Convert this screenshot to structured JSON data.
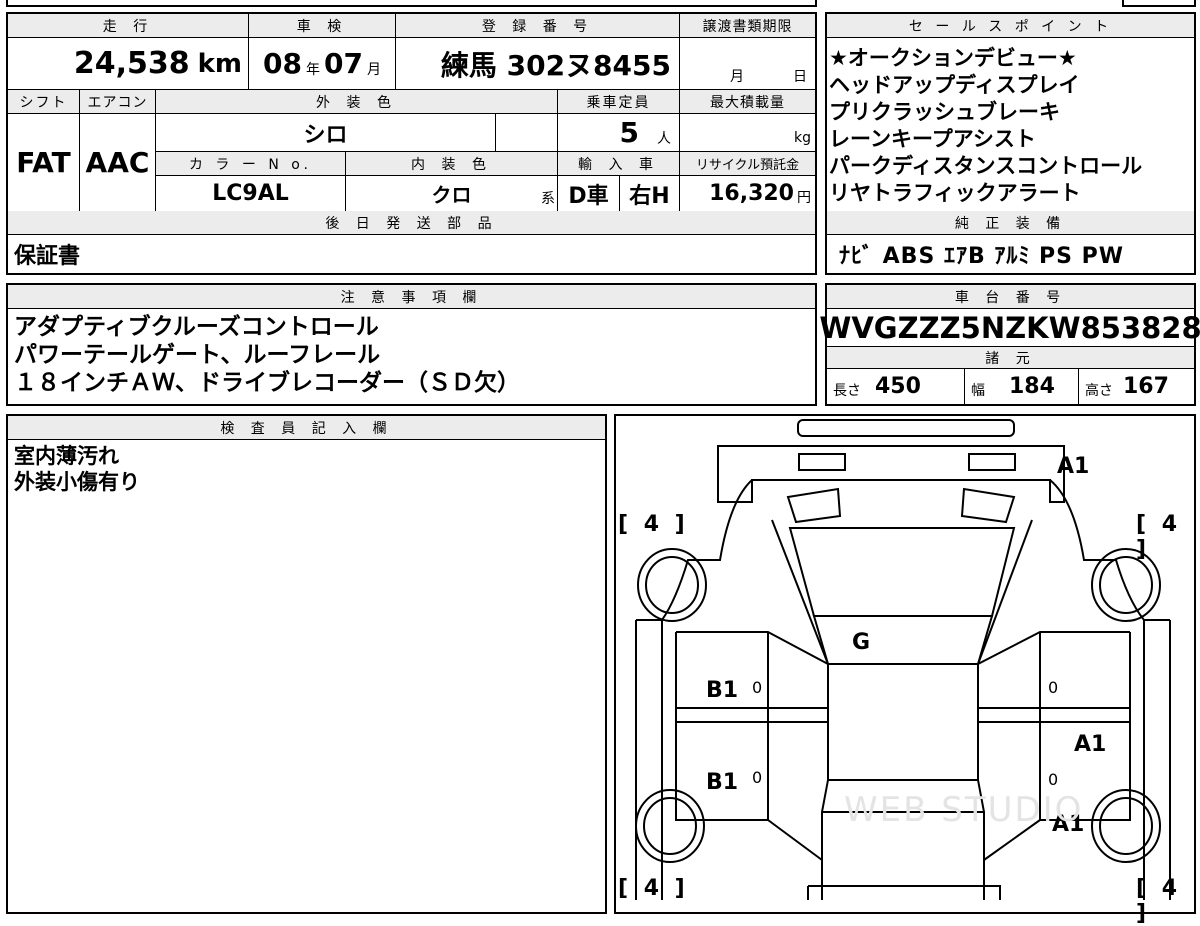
{
  "top": {
    "mileage_label": "走 行",
    "mileage_value": "24,538",
    "mileage_unit": "km",
    "shaken_label": "車 検",
    "shaken_year": "08",
    "shaken_year_unit": "年",
    "shaken_month": "07",
    "shaken_month_unit": "月",
    "reg_label": "登 録 番 号",
    "reg_value": "練馬 302ヌ8455",
    "transfer_label": "譲渡書類期限",
    "transfer_month": "月",
    "transfer_day": "日"
  },
  "mid": {
    "shift_label": "シフト",
    "shift_value": "FAT",
    "ac_label": "エアコン",
    "ac_value": "AAC",
    "color_label": "外 装 色",
    "color_value": "シロ",
    "capacity_label": "乗車定員",
    "capacity_value": "5",
    "capacity_unit": "人",
    "load_label": "最大積載量",
    "load_unit": "kg",
    "color_no_label": "カ ラ ー N o.",
    "color_no_value": "LC9AL",
    "interior_label": "内 装 色",
    "interior_value": "クロ",
    "interior_unit": "系",
    "import_label": "輸 入 車",
    "import_value_1": "D車",
    "import_value_2": "右H",
    "recycle_label": "リサイクル預託金",
    "recycle_value": "16,320",
    "recycle_unit": "円"
  },
  "delivery": {
    "label": "後 日 発 送 部 品",
    "value": "保証書"
  },
  "sales_points": {
    "label": "セ ー ル ス ポ イ ン ト",
    "items": [
      "★オークションデビュー★",
      "ヘッドアップディスプレイ",
      "プリクラッシュブレーキ",
      "レーンキープアシスト",
      "パークディスタンスコントロール",
      "リヤトラフィックアラート"
    ]
  },
  "equipment": {
    "label": "純 正 装 備",
    "value": "ﾅﾋﾞ ABS ｴｱB ｱﾙﾐ PS PW"
  },
  "notes": {
    "label": "注 意 事 項 欄",
    "lines": [
      "アダプティブクルーズコントロール",
      "パワーテールゲート、ルーフレール",
      "１８インチＡＷ、ドライブレコーダー（ＳＤ欠）"
    ]
  },
  "chassis": {
    "label": "車 台 番 号",
    "value": "WVGZZZ5NZKW853828"
  },
  "specs": {
    "label": "諸 元",
    "length_label": "長さ",
    "length_value": "450",
    "width_label": "幅",
    "width_value": "184",
    "height_label": "高さ",
    "height_value": "167"
  },
  "inspector": {
    "label": "検 査 員 記 入 欄",
    "lines": [
      "室内薄汚れ",
      "外装小傷有り"
    ]
  },
  "diagram": {
    "tire_tl": "[ 4 ]",
    "tire_tr": "[ 4 ]",
    "tire_bl": "[ 4 ]",
    "tire_br": "[ 4 ]",
    "marks": {
      "front": "A1",
      "glass": "G",
      "left_front_door": "B1",
      "left_rear_door": "B1",
      "right_rear_door": "A1",
      "right_rear_quarter": "A1",
      "zero_1": "0",
      "zero_2": "0",
      "zero_3": "0",
      "zero_4": "0"
    }
  },
  "watermark": "WEB STUDIO"
}
